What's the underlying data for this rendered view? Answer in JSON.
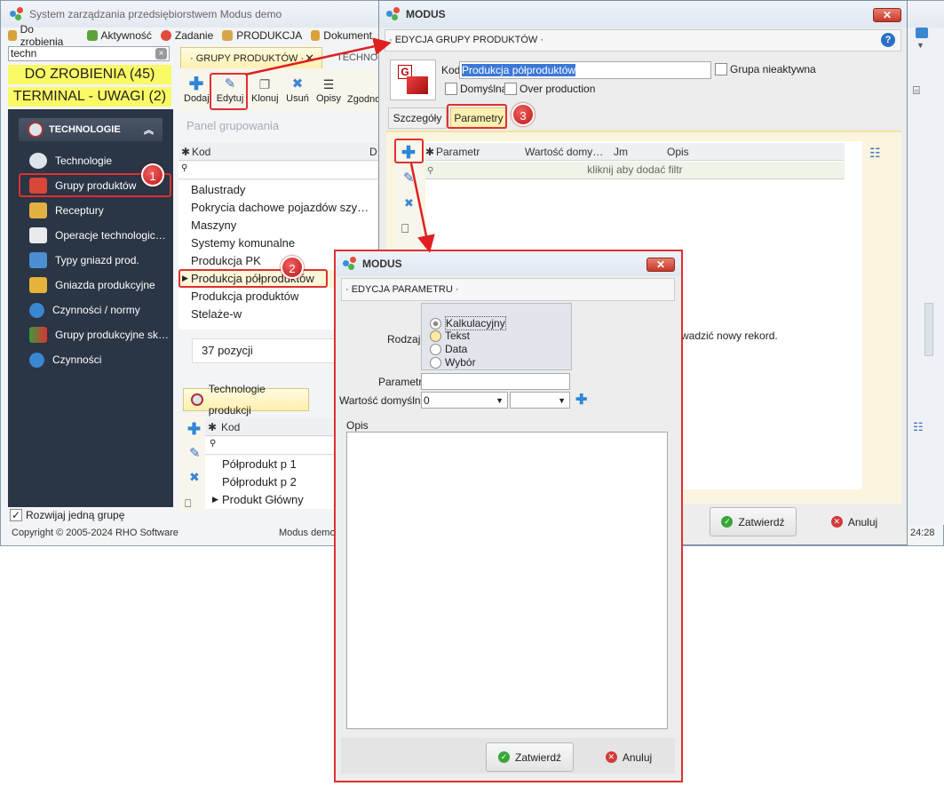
{
  "main_window": {
    "title": "System zarządzania przedsiębiorstwem Modus demo",
    "toolbar": [
      "Do zrobienia",
      "Aktywność",
      "Zadanie",
      "PRODUKCJA",
      "Dokument"
    ],
    "search_value": "techn",
    "todo_banner": "DO ZROBIENIA (45)",
    "terminal_banner": "TERMINAL - UWAGI (2)",
    "section_title": "TECHNOLOGIE",
    "nav_items": [
      "Technologie",
      "Grupy produktów",
      "Receptury",
      "Operacje technologic…",
      "Typy gniazd prod.",
      "Gniazda produkcyjne",
      "Czynności / normy",
      "Grupy produkcyjne sk…",
      "Czynności"
    ],
    "expand_one_label": "Rozwijaj jedną grupę",
    "copyright": "Copyright © 2005-2024 RHO Software",
    "status_center": "Modus demo",
    "status_time": "24:28"
  },
  "groups_tab": {
    "tab_label": "· GRUPY PRODUKTÓW ·",
    "tab2_label": "TECHNOL",
    "buttons": [
      "Dodaj",
      "Edytuj",
      "Klonuj",
      "Usuń",
      "Opisy",
      "Zgodno"
    ],
    "group_panel": "Panel grupowania",
    "col_kod": "Kod",
    "col_d": "D",
    "rows": [
      "Balustrady",
      "Pokrycia dachowe pojazdów szy…",
      "Maszyny",
      "Systemy komunalne",
      "Produkcja PK",
      "Produkcja półproduktów",
      "Produkcja produktów",
      "Stelaże-w"
    ],
    "count": "37 pozycji"
  },
  "tech_tab": {
    "tab_label": "Technologie produkcji",
    "col_kod": "Kod",
    "rows": [
      "Półprodukt p 1",
      "Półprodukt p 2",
      "Produkt Główny"
    ]
  },
  "dialog1": {
    "title": "MODUS",
    "section": "· EDYCJA GRUPY PRODUKTÓW ·",
    "kod_label": "Kod",
    "kod_value": "Produkcja półproduktów",
    "inactive_label": "Grupa nieaktywna",
    "default_label": "Domyślna",
    "overprod_label": "Over production",
    "tab_details": "Szczegóły",
    "tab_params": "Parametry",
    "cols": [
      "Parametr",
      "Wartość domy…",
      "Jm",
      "Opis"
    ],
    "filter_hint": "kliknij aby dodać filtr",
    "new_record_hint": "wadzić nowy rekord.",
    "ok": "Zatwierdź",
    "cancel": "Anuluj"
  },
  "dialog2": {
    "title": "MODUS",
    "section": "· EDYCJA PARAMETRU ·",
    "rodzaj_label": "Rodzaj",
    "radio_options": [
      "Kalkulacyjny",
      "Tekst",
      "Data",
      "Wybór"
    ],
    "param_label": "Parametr",
    "default_value_label": "Wartość domyślna",
    "default_value": "0",
    "opis_label": "Opis",
    "ok": "Zatwierdź",
    "cancel": "Anuluj"
  },
  "callouts": [
    "1",
    "2",
    "3"
  ]
}
